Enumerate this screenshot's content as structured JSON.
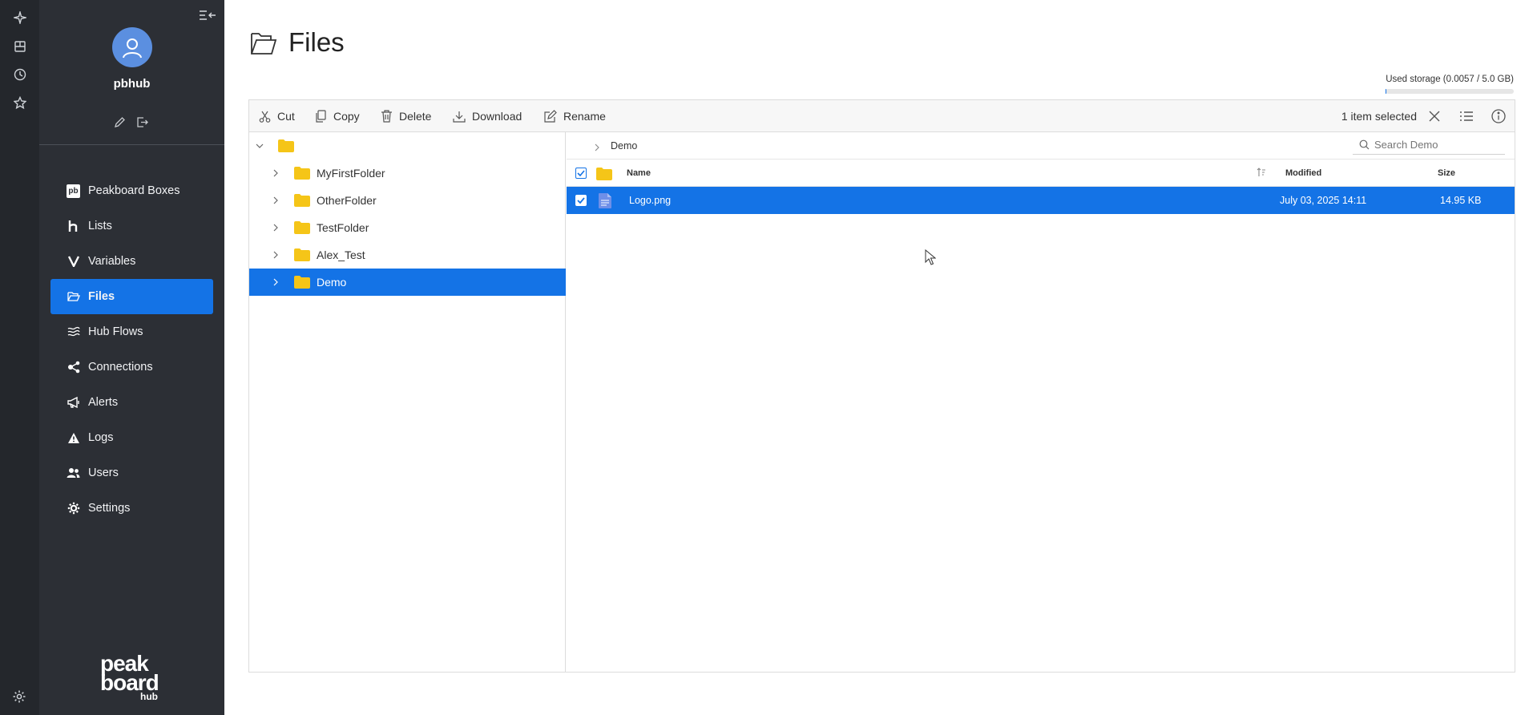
{
  "sidebar": {
    "username": "pbhub",
    "items": [
      {
        "label": "Peakboard Boxes",
        "icon": "pb-icon"
      },
      {
        "label": "Lists",
        "icon": "lists-icon"
      },
      {
        "label": "Variables",
        "icon": "variables-icon"
      },
      {
        "label": "Files",
        "icon": "folder-icon",
        "active": true
      },
      {
        "label": "Hub Flows",
        "icon": "flows-icon"
      },
      {
        "label": "Connections",
        "icon": "connections-icon"
      },
      {
        "label": "Alerts",
        "icon": "megaphone-icon"
      },
      {
        "label": "Logs",
        "icon": "warning-icon"
      },
      {
        "label": "Users",
        "icon": "users-icon"
      },
      {
        "label": "Settings",
        "icon": "gear-icon"
      }
    ],
    "logo": {
      "line1": "peak",
      "line2": "board",
      "line3": "hub"
    },
    "pb_icon_text": "pb"
  },
  "page": {
    "title": "Files",
    "storage_label": "Used storage (0.0057 / 5.0 GB)",
    "storage_fraction": 0.00114
  },
  "toolbar": {
    "cut": "Cut",
    "copy": "Copy",
    "delete": "Delete",
    "download": "Download",
    "rename": "Rename",
    "selection": "1 item selected"
  },
  "tree": {
    "folders": [
      "MyFirstFolder",
      "OtherFolder",
      "TestFolder",
      "Alex_Test",
      "Demo"
    ],
    "selected": "Demo"
  },
  "files": {
    "breadcrumb": "Demo",
    "search_placeholder": "Search Demo",
    "columns": {
      "name": "Name",
      "modified": "Modified",
      "size": "Size"
    },
    "rows": [
      {
        "name": "Logo.png",
        "modified": "July 03, 2025 14:11",
        "size": "14.95 KB",
        "selected": true
      }
    ]
  },
  "colors": {
    "accent": "#1473e6",
    "sidebar_bg": "#2c2f35",
    "rail_bg": "#24272c",
    "folder": "#f5c518"
  }
}
